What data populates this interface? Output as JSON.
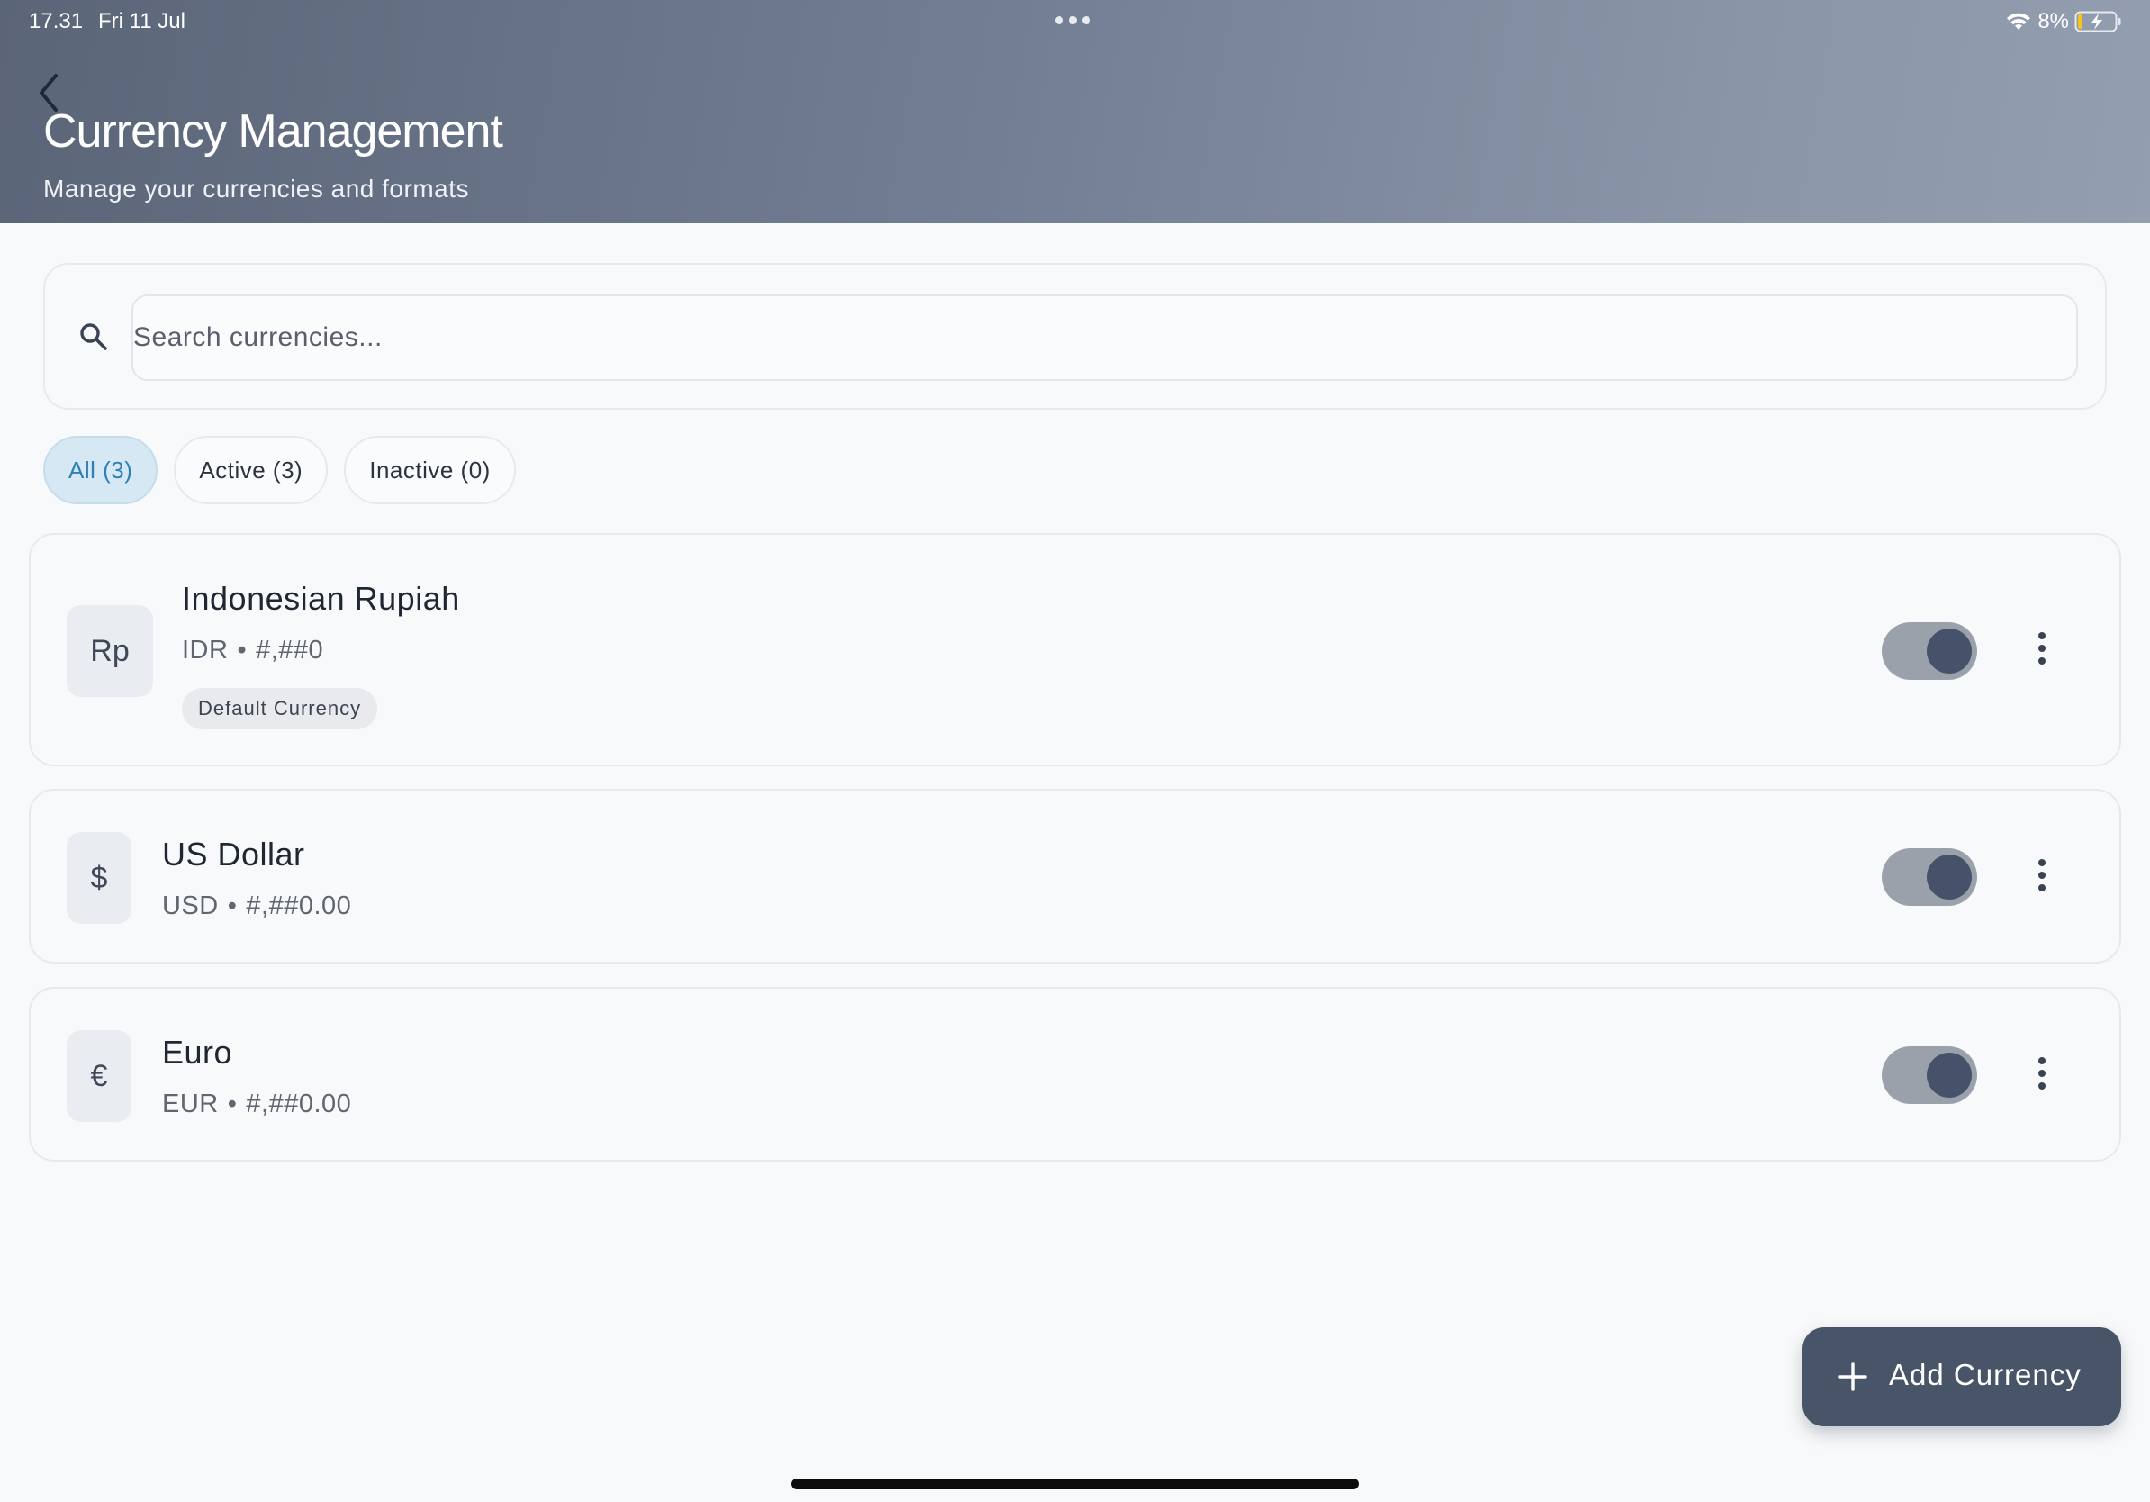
{
  "status_bar": {
    "time": "17.31",
    "date": "Fri 11 Jul",
    "battery": "8%"
  },
  "header": {
    "title": "Currency Management",
    "subtitle": "Manage your currencies and formats",
    "background_colors": [
      "#5b6578",
      "#939eb0"
    ]
  },
  "search": {
    "placeholder": "Search currencies...",
    "value": ""
  },
  "filters": [
    {
      "label": "All (3)",
      "active": true
    },
    {
      "label": "Active (3)",
      "active": false
    },
    {
      "label": "Inactive (0)",
      "active": false
    }
  ],
  "currencies": [
    {
      "symbol": "Rp",
      "name": "Indonesian Rupiah",
      "code": "IDR",
      "format": "#,##0",
      "badge": "Default Currency",
      "enabled": true
    },
    {
      "symbol": "$",
      "name": "US Dollar",
      "code": "USD",
      "format": "#,##0.00",
      "badge": "",
      "enabled": true
    },
    {
      "symbol": "€",
      "name": "Euro",
      "code": "EUR",
      "format": "#,##0.00",
      "badge": "",
      "enabled": true
    }
  ],
  "meta_separator": "•",
  "fab": {
    "label": "Add Currency"
  },
  "colors": {
    "accent": "#2e7fb5",
    "fab": "#485569",
    "toggle_track": "#9aa1ab",
    "toggle_knob": "#45526a"
  }
}
